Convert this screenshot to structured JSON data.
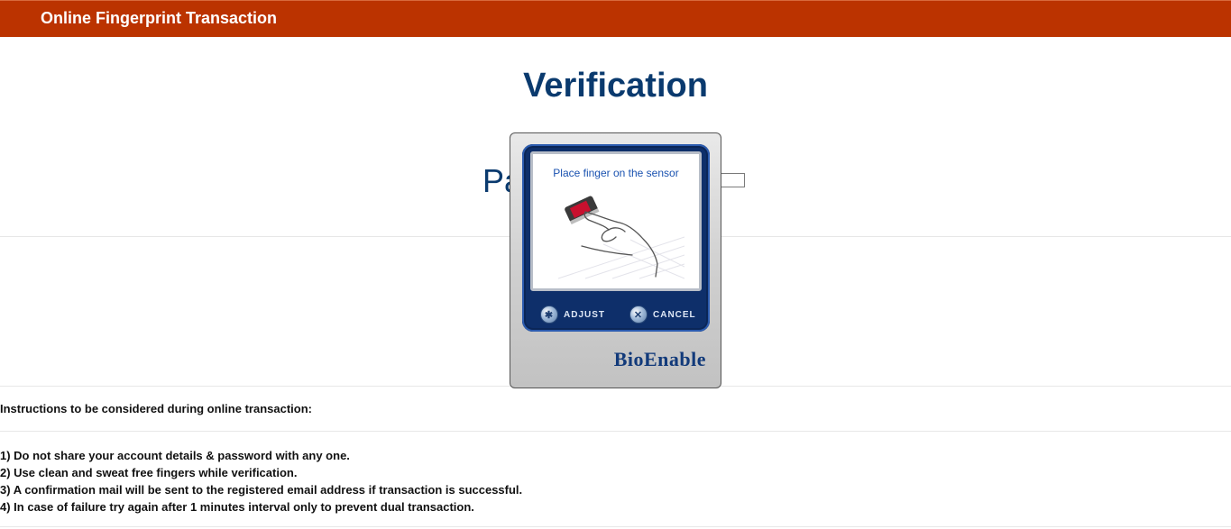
{
  "header": {
    "title": "Online Fingerprint Transaction"
  },
  "main": {
    "heading": "Verification",
    "password_label_visible": "Pa",
    "password_value": ""
  },
  "dialog": {
    "prompt": "Place finger on the sensor",
    "adjust_label": "ADJUST",
    "cancel_label": "CANCEL",
    "brand": "BioEnable"
  },
  "instructions": {
    "heading": "Instructions to be considered during online transaction:",
    "items": [
      "1) Do not share your account details & password with any one.",
      "2) Use clean and sweat free fingers while verification.",
      "3) A confirmation mail will be sent to the registered email address if transaction is successful.",
      "4) In case of failure try again after 1 minutes interval only to prevent dual transaction."
    ]
  },
  "colors": {
    "header_bg": "#bb3300",
    "title_blue": "#0a3a6e",
    "dialog_frame": "#0e2f6a"
  }
}
